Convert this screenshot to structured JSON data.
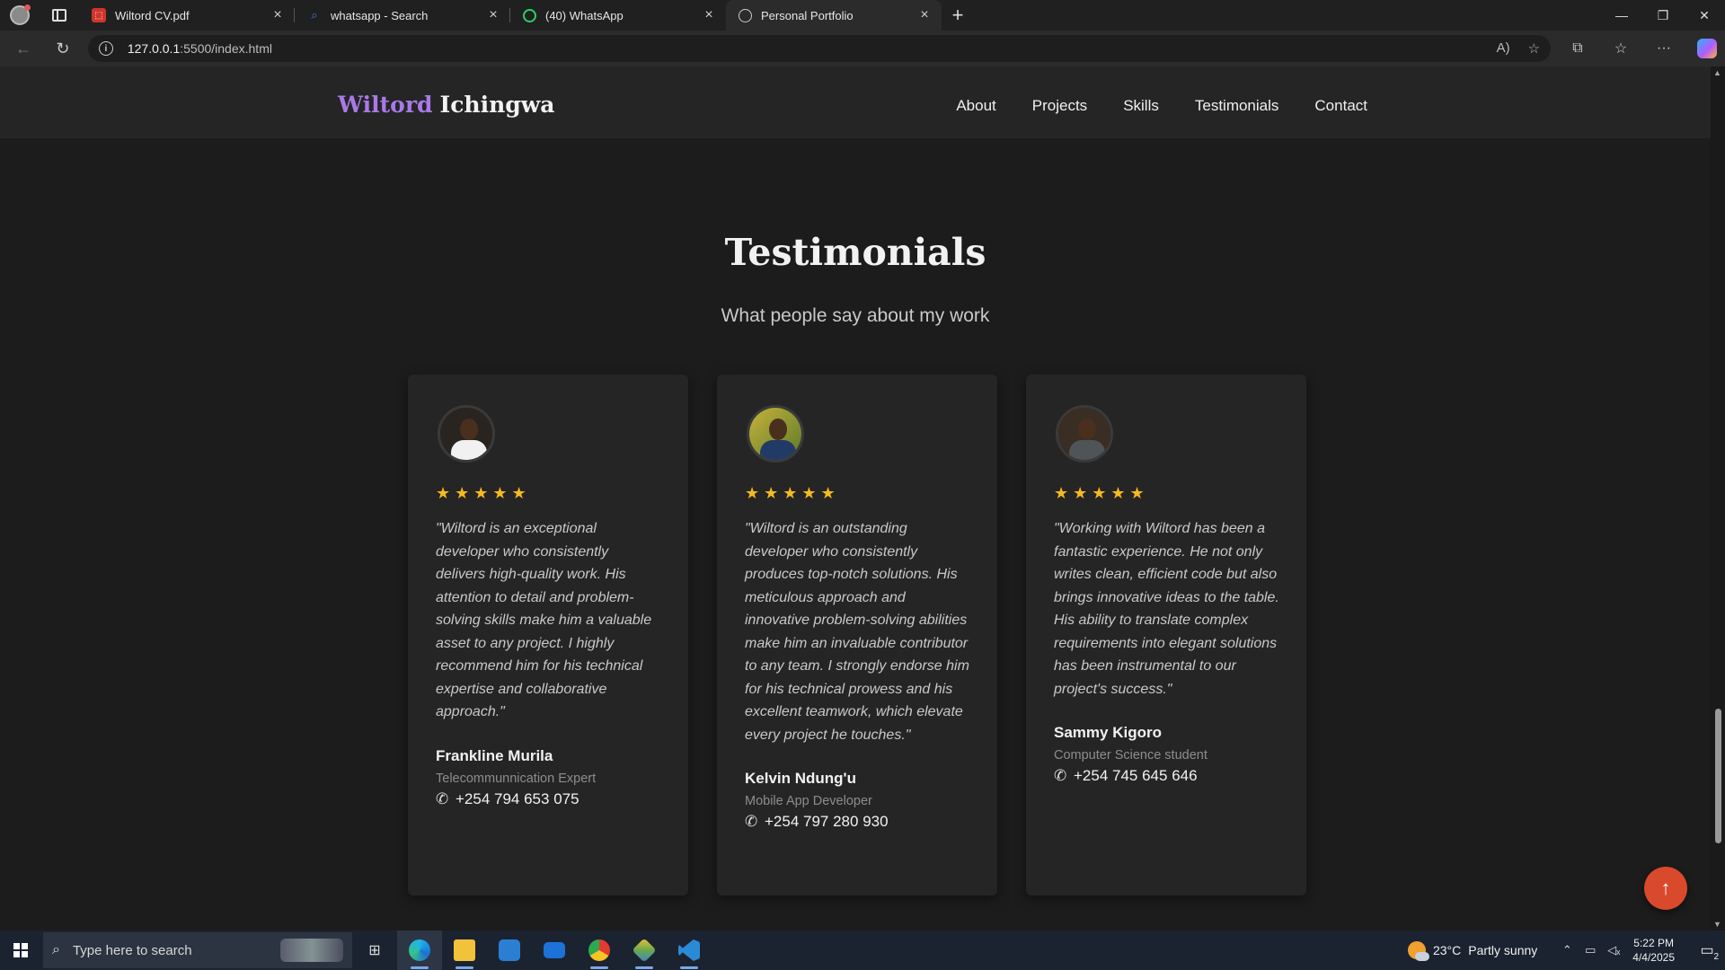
{
  "browser": {
    "tabs": [
      {
        "title": "Wiltord CV.pdf",
        "icon": "pdf-icon",
        "color": "#d0342c"
      },
      {
        "title": "whatsapp - Search",
        "icon": "search-icon",
        "color": "#3b7ddd"
      },
      {
        "title": "(40) WhatsApp",
        "icon": "whatsapp-icon",
        "color": "#25d366"
      },
      {
        "title": "Personal Portfolio",
        "icon": "globe-icon",
        "color": "#cccccc"
      }
    ],
    "url_host": "127.0.0.1",
    "url_path": ":5500/index.html"
  },
  "site": {
    "brand_first": "Wiltord",
    "brand_last": "Ichingwa",
    "nav": [
      "About",
      "Projects",
      "Skills",
      "Testimonials",
      "Contact"
    ]
  },
  "testimonials": {
    "title": "Testimonials",
    "subtitle": "What people say about my work",
    "stars": "★★★★★",
    "rating": 5,
    "cards": [
      {
        "quote": "\"Wiltord is an exceptional developer who consistently delivers high-quality work. His attention to detail and problem-solving skills make him a valuable asset to any project. I highly recommend him for his technical expertise and collaborative approach.\"",
        "name": "Frankline Murila",
        "role": "Telecommunnication Expert",
        "phone": "+254 794 653 075"
      },
      {
        "quote": "\"Wiltord is an outstanding developer who consistently produces top-notch solutions. His meticulous approach and innovative problem-solving abilities make him an invaluable contributor to any team. I strongly endorse him for his technical prowess and his excellent teamwork, which elevate every project he touches.\"",
        "name": "Kelvin Ndung'u",
        "role": "Mobile App Developer",
        "phone": "+254 797 280 930"
      },
      {
        "quote": "\"Working with Wiltord has been a fantastic experience. He not only writes clean, efficient code but also brings innovative ideas to the table. His ability to translate complex requirements into elegant solutions has been instrumental to our project's success.\"",
        "name": "Sammy Kigoro",
        "role": "Computer Science student",
        "phone": "+254 745 645 646"
      }
    ]
  },
  "taskbar": {
    "search_placeholder": "Type here to search",
    "weather_temp": "23°C",
    "weather_desc": "Partly sunny",
    "time": "5:22 PM",
    "date": "4/4/2025",
    "notification_count": "2"
  },
  "colors": {
    "accent": "#a979e8",
    "star": "#f5b921",
    "back_to_top": "#d84a2b"
  }
}
